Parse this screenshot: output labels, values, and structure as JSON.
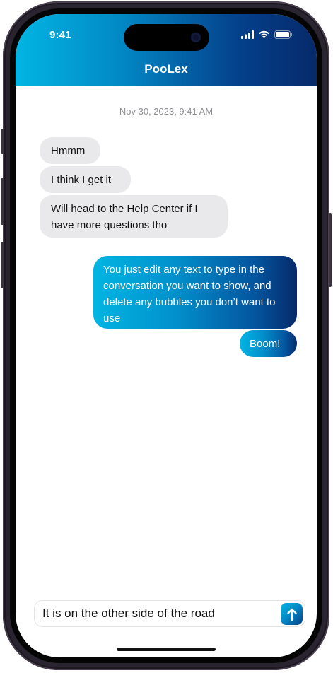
{
  "status_bar": {
    "time": "9:41",
    "icons": [
      "cellular-signal-icon",
      "wifi-icon",
      "battery-icon"
    ]
  },
  "header": {
    "title": "PooLex"
  },
  "conversation": {
    "timestamp": "Nov 30, 2023, 9:41 AM",
    "incoming": [
      {
        "text": "Hmmm"
      },
      {
        "text": "I think I get it"
      },
      {
        "text": "Will head to the Help Center if I have more questions tho"
      }
    ],
    "outgoing": [
      {
        "text": "You just edit any text to type in the conversation you want to show, and delete any bubbles you don’t want to use"
      },
      {
        "text": "Boom!"
      }
    ]
  },
  "composer": {
    "value": "It is on the other side of the road",
    "send_icon": "arrow-up-icon"
  },
  "colors": {
    "accent_start": "#02b5e3",
    "accent_end": "#062a6a",
    "incoming_bubble": "#e9e9eb",
    "timestamp_text": "#8e8e93"
  }
}
